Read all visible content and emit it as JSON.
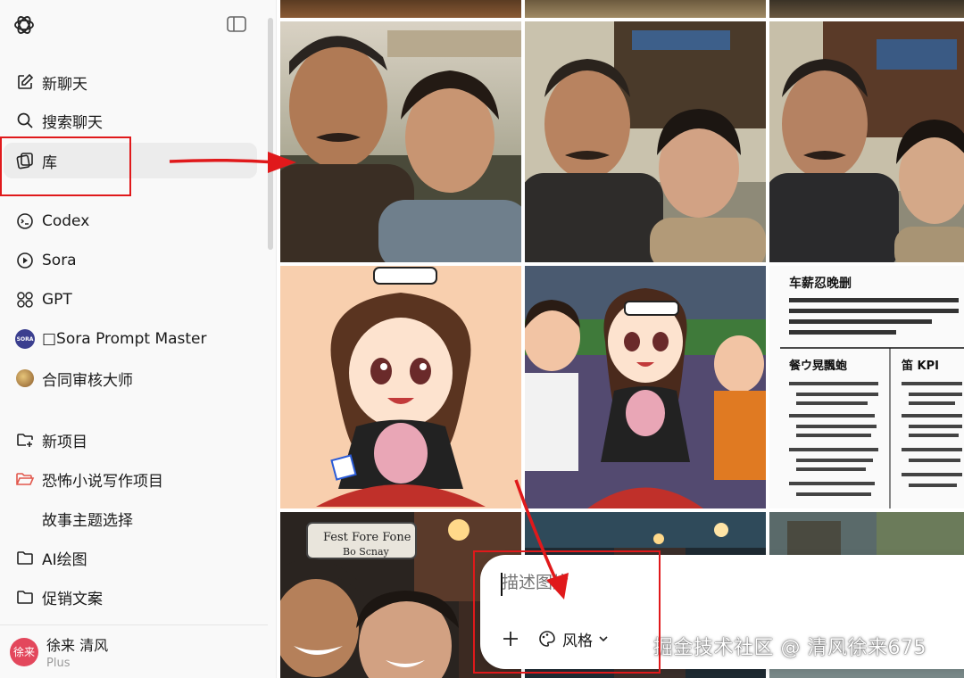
{
  "sidebar": {
    "items": [
      {
        "label": "新聊天",
        "icon": "edit-icon"
      },
      {
        "label": "搜索聊天",
        "icon": "search-icon"
      },
      {
        "label": "库",
        "icon": "library-icon"
      },
      {
        "label": "Codex",
        "icon": "codex-icon"
      },
      {
        "label": "Sora",
        "icon": "sora-play-icon"
      },
      {
        "label": "GPT",
        "icon": "gpt-grid-icon"
      },
      {
        "label": "□Sora Prompt Master",
        "icon": "sora-avatar-icon",
        "avatar_text": "SORA"
      },
      {
        "label": "合同审核大师",
        "icon": "contract-avatar-icon"
      },
      {
        "label": "新项目",
        "icon": "new-folder-icon"
      },
      {
        "label": "恐怖小说写作项目",
        "icon": "folder-open-icon"
      },
      {
        "label": "故事主题选择",
        "icon": ""
      },
      {
        "label": "AI绘图",
        "icon": "folder-icon"
      },
      {
        "label": "促销文案",
        "icon": "folder-icon"
      }
    ],
    "user": {
      "avatar_text": "徐来",
      "name": "徐来 清风",
      "plan": "Plus"
    }
  },
  "gallery": {
    "sign_text": [
      "Fest Fore Fone",
      "Bo Scnay"
    ],
    "doc_heading": "车薪忍晚删",
    "doc_col_left": "餐ウ晃飄蚫",
    "doc_col_right": "笛 KPI"
  },
  "composer": {
    "placeholder": "描述图片",
    "style_label": "风格"
  },
  "watermark": "掘金技术社区 @ 清风徐来675",
  "colors": {
    "annotation": "#e0191b",
    "sidebar_bg": "#f9f9f9",
    "active_item": "#ececec"
  }
}
